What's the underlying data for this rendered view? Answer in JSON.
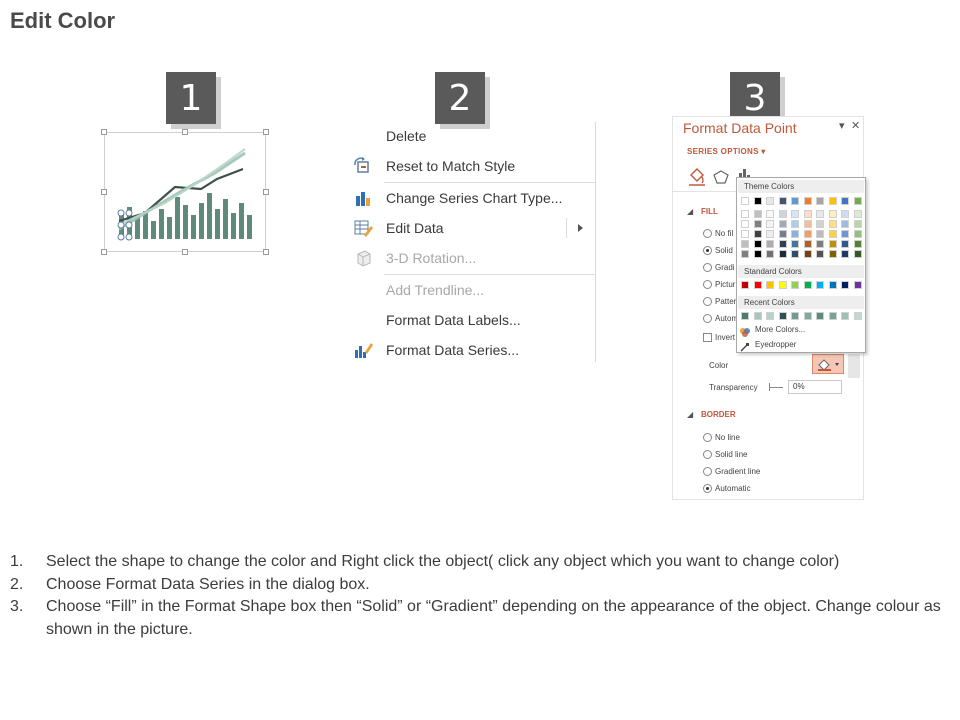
{
  "title": "Edit Color",
  "steps": [
    "1",
    "2",
    "3"
  ],
  "context_menu": {
    "items": [
      {
        "label": "Delete",
        "disabled": false,
        "icon": "none"
      },
      {
        "label": "Reset to Match Style",
        "disabled": false,
        "icon": "reset-style-icon"
      },
      {
        "label": "Change Series Chart Type...",
        "disabled": false,
        "icon": "bar-chart-icon"
      },
      {
        "label": "Edit Data",
        "disabled": false,
        "icon": "edit-data-icon"
      },
      {
        "label": "3-D Rotation...",
        "disabled": true,
        "icon": "cube-icon"
      },
      {
        "label": "Add Trendline...",
        "disabled": true,
        "icon": "none"
      },
      {
        "label": "Format Data Labels...",
        "disabled": false,
        "icon": "none"
      },
      {
        "label": "Format Data Series...",
        "disabled": false,
        "icon": "format-series-icon"
      }
    ]
  },
  "format_pane": {
    "title": "Format Data Point",
    "series_options": "SERIES OPTIONS",
    "fill_section": "FILL",
    "fill_options": [
      "No fil",
      "Solid",
      "Gradi",
      "Pictur",
      "Patter",
      "Autom"
    ],
    "invert": "Invert",
    "color_label": "Color",
    "transparency_label": "Transparency",
    "transparency_value": "0%",
    "border_section": "BORDER",
    "border_options": [
      "No line",
      "Solid line",
      "Gradient line",
      "Automatic"
    ]
  },
  "palette": {
    "theme_header": "Theme Colors",
    "standard_header": "Standard Colors",
    "recent_header": "Recent Colors",
    "more_colors": "More Colors...",
    "eyedropper": "Eyedropper",
    "theme_top": [
      "#ffffff",
      "#000000",
      "#e7e6e6",
      "#44546a",
      "#5b9bd5",
      "#ed7d31",
      "#a5a5a5",
      "#ffc000",
      "#4472c4",
      "#70ad47"
    ],
    "standard": [
      "#c00000",
      "#ff0000",
      "#ffc000",
      "#ffff00",
      "#92d050",
      "#00b050",
      "#00b0f0",
      "#0070c0",
      "#002060",
      "#7030a0"
    ],
    "recent": [
      "#4e7a6a",
      "#a7c7bd",
      "#b4d3cc",
      "#2f4f4f",
      "#6f9c8e",
      "#82a99c",
      "#5c8a7c",
      "#7aa394",
      "#9cc2b5",
      "#c1d9d1"
    ]
  },
  "instructions": [
    "Select the shape to change the color and Right click the object( click any object which you want to change color)",
    "Choose Format Data Series in the dialog box.",
    "Choose “Fill” in the Format Shape box then “Solid” or “Gradient” depending on the appearance of the object. Change colour as shown in the picture."
  ],
  "instruction_numbers": [
    "1.",
    "2.",
    "3."
  ]
}
